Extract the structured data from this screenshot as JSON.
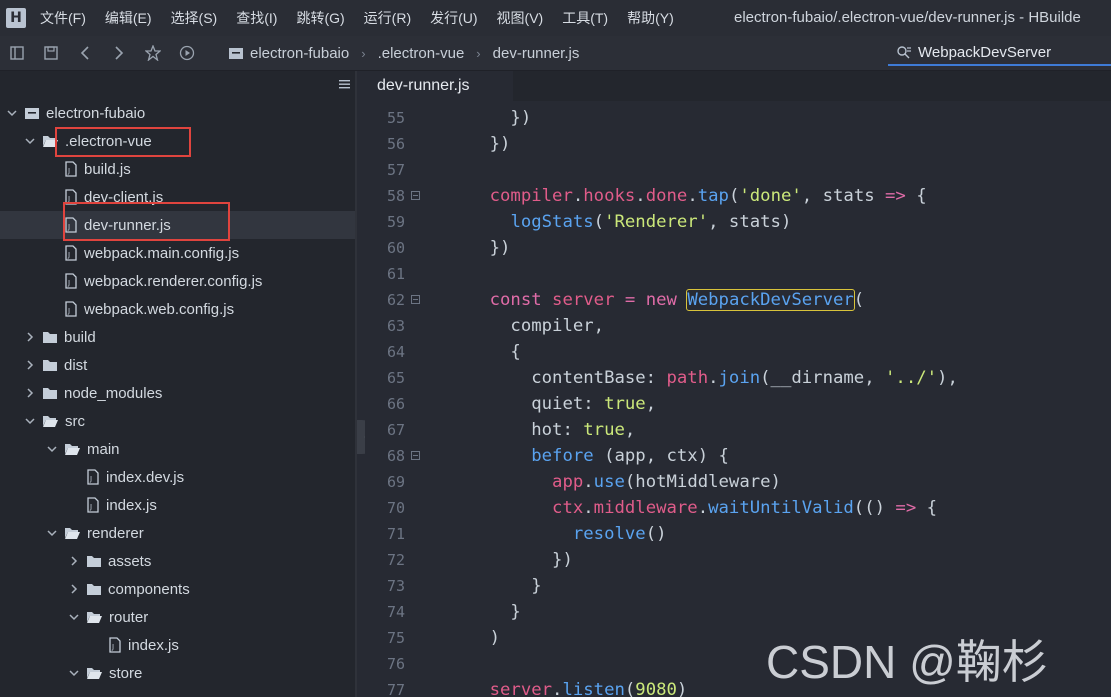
{
  "menubar": {
    "logo": "H",
    "items": [
      "文件(F)",
      "编辑(E)",
      "选择(S)",
      "查找(I)",
      "跳转(G)",
      "运行(R)",
      "发行(U)",
      "视图(V)",
      "工具(T)",
      "帮助(Y)"
    ],
    "title": "electron-fubaio/.electron-vue/dev-runner.js - HBuilde"
  },
  "breadcrumb": [
    "electron-fubaio",
    ".electron-vue",
    "dev-runner.js"
  ],
  "search": {
    "value": "WebpackDevServer"
  },
  "tree": [
    {
      "label": "electron-fubaio",
      "chevron": "down",
      "icon": "project-icon"
    },
    {
      "label": ".electron-vue",
      "chevron": "down",
      "icon": "folder-open-icon"
    },
    {
      "label": "build.js",
      "chevron": "",
      "icon": "file-js-icon"
    },
    {
      "label": "dev-client.js",
      "chevron": "",
      "icon": "file-js-icon"
    },
    {
      "label": "dev-runner.js",
      "chevron": "",
      "icon": "file-js-icon"
    },
    {
      "label": "webpack.main.config.js",
      "chevron": "",
      "icon": "file-js-icon"
    },
    {
      "label": "webpack.renderer.config.js",
      "chevron": "",
      "icon": "file-js-icon"
    },
    {
      "label": "webpack.web.config.js",
      "chevron": "",
      "icon": "file-js-icon"
    },
    {
      "label": "build",
      "chevron": "right",
      "icon": "folder-icon"
    },
    {
      "label": "dist",
      "chevron": "right",
      "icon": "folder-icon"
    },
    {
      "label": "node_modules",
      "chevron": "right",
      "icon": "folder-icon"
    },
    {
      "label": "src",
      "chevron": "down",
      "icon": "folder-open-icon"
    },
    {
      "label": "main",
      "chevron": "down",
      "icon": "folder-open-icon"
    },
    {
      "label": "index.dev.js",
      "chevron": "",
      "icon": "file-js-icon"
    },
    {
      "label": "index.js",
      "chevron": "",
      "icon": "file-js-icon"
    },
    {
      "label": "renderer",
      "chevron": "down",
      "icon": "folder-open-icon"
    },
    {
      "label": "assets",
      "chevron": "right",
      "icon": "folder-icon"
    },
    {
      "label": "components",
      "chevron": "right",
      "icon": "folder-icon"
    },
    {
      "label": "router",
      "chevron": "down",
      "icon": "folder-open-icon"
    },
    {
      "label": "index.js",
      "chevron": "",
      "icon": "file-js-icon"
    },
    {
      "label": "store",
      "chevron": "down",
      "icon": "folder-open-icon"
    }
  ],
  "tab": {
    "label": "dev-runner.js"
  },
  "code": [
    {
      "n": "55",
      "fold": false,
      "tokens": [
        [
          "p",
          "      })"
        ]
      ]
    },
    {
      "n": "56",
      "fold": false,
      "tokens": [
        [
          "p",
          "    })"
        ]
      ]
    },
    {
      "n": "57",
      "fold": false,
      "tokens": []
    },
    {
      "n": "58",
      "fold": true,
      "tokens": [
        [
          "v",
          "    compiler"
        ],
        [
          "p",
          "."
        ],
        [
          "v",
          "hooks"
        ],
        [
          "p",
          "."
        ],
        [
          "v",
          "done"
        ],
        [
          "p",
          "."
        ],
        [
          "f",
          "tap"
        ],
        [
          "p",
          "("
        ],
        [
          "s",
          "'done'"
        ],
        [
          "p",
          ", stats "
        ],
        [
          "k",
          "=>"
        ],
        [
          "p",
          " {"
        ]
      ]
    },
    {
      "n": "59",
      "fold": false,
      "tokens": [
        [
          "p",
          "      "
        ],
        [
          "f",
          "logStats"
        ],
        [
          "p",
          "("
        ],
        [
          "s",
          "'Renderer'"
        ],
        [
          "p",
          ", stats)"
        ]
      ]
    },
    {
      "n": "60",
      "fold": false,
      "tokens": [
        [
          "p",
          "    })"
        ]
      ]
    },
    {
      "n": "61",
      "fold": false,
      "tokens": []
    },
    {
      "n": "62",
      "fold": true,
      "tokens": [
        [
          "k",
          "    const"
        ],
        [
          "p",
          " "
        ],
        [
          "v",
          "server"
        ],
        [
          "p",
          " "
        ],
        [
          "k",
          "="
        ],
        [
          "p",
          " "
        ],
        [
          "k",
          "new"
        ],
        [
          "p",
          " "
        ],
        [
          "h",
          "WebpackDevServer"
        ],
        [
          "p",
          "("
        ]
      ]
    },
    {
      "n": "63",
      "fold": false,
      "tokens": [
        [
          "p",
          "      compiler,"
        ]
      ]
    },
    {
      "n": "64",
      "fold": false,
      "tokens": [
        [
          "p",
          "      {"
        ]
      ]
    },
    {
      "n": "65",
      "fold": false,
      "tokens": [
        [
          "p",
          "        contentBase: "
        ],
        [
          "v",
          "path"
        ],
        [
          "p",
          "."
        ],
        [
          "f",
          "join"
        ],
        [
          "p",
          "(__dirname, "
        ],
        [
          "s",
          "'../'"
        ],
        [
          "p",
          "),"
        ]
      ]
    },
    {
      "n": "66",
      "fold": false,
      "tokens": [
        [
          "p",
          "        quiet: "
        ],
        [
          "s",
          "true"
        ],
        [
          "p",
          ","
        ]
      ]
    },
    {
      "n": "67",
      "fold": false,
      "tokens": [
        [
          "p",
          "        hot: "
        ],
        [
          "s",
          "true"
        ],
        [
          "p",
          ","
        ]
      ]
    },
    {
      "n": "68",
      "fold": true,
      "tokens": [
        [
          "p",
          "        "
        ],
        [
          "f",
          "before"
        ],
        [
          "p",
          " (app, ctx) {"
        ]
      ]
    },
    {
      "n": "69",
      "fold": false,
      "tokens": [
        [
          "p",
          "          "
        ],
        [
          "v",
          "app"
        ],
        [
          "p",
          "."
        ],
        [
          "f",
          "use"
        ],
        [
          "p",
          "(hotMiddleware)"
        ]
      ]
    },
    {
      "n": "70",
      "fold": false,
      "tokens": [
        [
          "p",
          "          "
        ],
        [
          "v",
          "ctx"
        ],
        [
          "p",
          "."
        ],
        [
          "v",
          "middleware"
        ],
        [
          "p",
          "."
        ],
        [
          "f",
          "waitUntilValid"
        ],
        [
          "p",
          "(() "
        ],
        [
          "k",
          "=>"
        ],
        [
          "p",
          " {"
        ]
      ]
    },
    {
      "n": "71",
      "fold": false,
      "tokens": [
        [
          "p",
          "            "
        ],
        [
          "f",
          "resolve"
        ],
        [
          "p",
          "()"
        ]
      ]
    },
    {
      "n": "72",
      "fold": false,
      "tokens": [
        [
          "p",
          "          })"
        ]
      ]
    },
    {
      "n": "73",
      "fold": false,
      "tokens": [
        [
          "p",
          "        }"
        ]
      ]
    },
    {
      "n": "74",
      "fold": false,
      "tokens": [
        [
          "p",
          "      }"
        ]
      ]
    },
    {
      "n": "75",
      "fold": false,
      "tokens": [
        [
          "p",
          "    )"
        ]
      ]
    },
    {
      "n": "76",
      "fold": false,
      "tokens": []
    },
    {
      "n": "77",
      "fold": false,
      "tokens": [
        [
          "v",
          "    server"
        ],
        [
          "p",
          "."
        ],
        [
          "f",
          "listen"
        ],
        [
          "p",
          "("
        ],
        [
          "s",
          "9080"
        ],
        [
          "p",
          ")"
        ]
      ]
    }
  ],
  "watermark": "CSDN @鞠杉",
  "colors": {
    "accent": "#3e7bd6",
    "annotation_red": "#e0443e",
    "match_outline": "#d8c33b"
  }
}
